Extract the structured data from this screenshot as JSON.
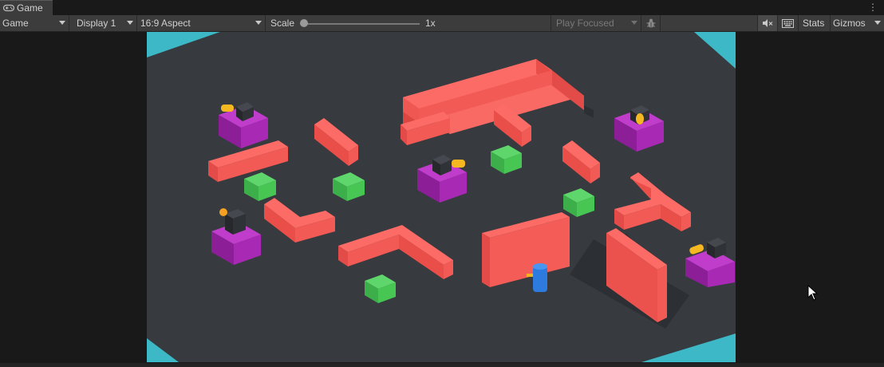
{
  "tab": {
    "label": "Game",
    "icon": "gamepad-icon"
  },
  "toolbar": {
    "mode": "Game",
    "display": "Display 1",
    "aspect": "16:9 Aspect",
    "scale_label": "Scale",
    "scale_value": "1x",
    "play_mode": "Play Focused",
    "stats": "Stats",
    "gizmos": "Gizmos",
    "icons": [
      "bug-icon",
      "mute-audio-icon",
      "keyboard-icon"
    ]
  },
  "colors": {
    "floor": "#373a3f",
    "wall": "#f2554f",
    "enemy_base": "#a428b0",
    "turret": "#2b2d31",
    "barrel": "#f0b21e",
    "pickup": "#44c653",
    "player": "#2e7be0",
    "corner": "#3db8c6"
  }
}
